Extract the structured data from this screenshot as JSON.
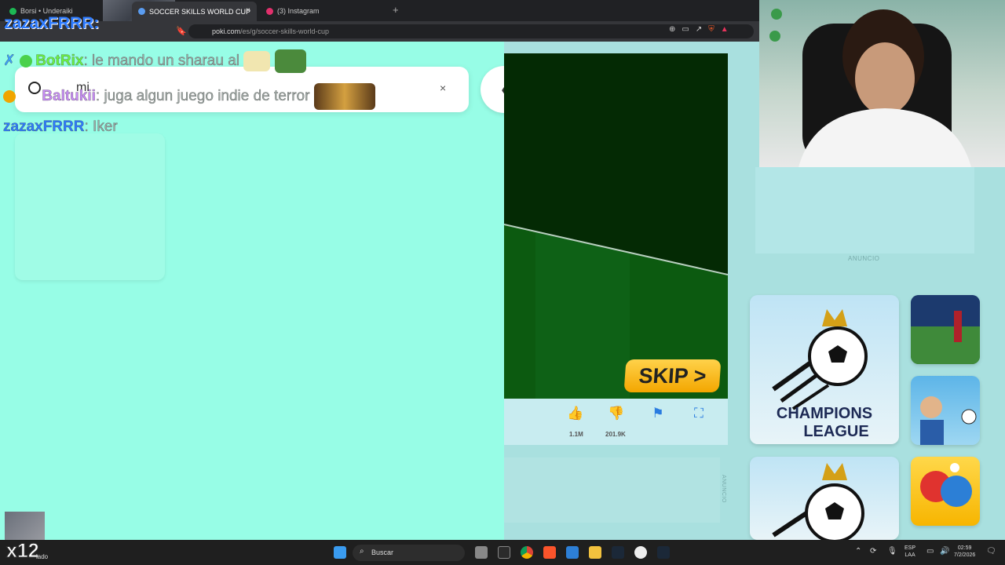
{
  "browser": {
    "tabs": [
      {
        "label": "Borsi • Underaiki",
        "icon_color": "#1db954"
      },
      {
        "label": "SOCCER SKILLS WORLD CUP",
        "icon_color": "#5a9cf0",
        "active": true
      },
      {
        "label": "(3) Instagram",
        "icon_color": "#e1306c"
      }
    ],
    "close_glyph": "×",
    "new_tab_glyph": "+",
    "url_host": "poki.com",
    "url_path": "/es/g/soccer-skills-world-cup"
  },
  "chat": {
    "top_user": "zazaxFRRR:",
    "messages": [
      {
        "user": "BotRix",
        "user_color": "#6bf541",
        "text": ": le mando un sharau al"
      },
      {
        "user": "Baltukii",
        "user_color": "#c78cf5",
        "text": ": juga algun juego indie de terror"
      },
      {
        "user": "zazaxFRRR",
        "user_color": "#2d7bff",
        "text": ": Iker"
      }
    ],
    "notif_fragment": "mi"
  },
  "poki": {
    "close_glyph": "×",
    "back_glyph": "‹",
    "like_count": "1.1M",
    "dislike_count": "201.9K",
    "skip_label": "SKIP >",
    "ad_label": "ANUNCIO",
    "ad_label_vertical": "ANUNCIO",
    "champions_line1": "CHAMPIONS",
    "champions_line2": "LEAGUE"
  },
  "taskbar": {
    "search_placeholder": "Buscar",
    "lang_line1": "ESP",
    "lang_line2": "LAA",
    "time": "02:59",
    "date": "7/2/2026",
    "overlay_multiplier": "x12",
    "overlay_text": "lado"
  },
  "icons": {
    "like": "thumbs-up-icon",
    "dislike": "thumbs-down-icon",
    "flag": "flag-icon",
    "fullscreen": "fullscreen-icon",
    "search": "search-icon",
    "windows": "windows-start-icon"
  }
}
